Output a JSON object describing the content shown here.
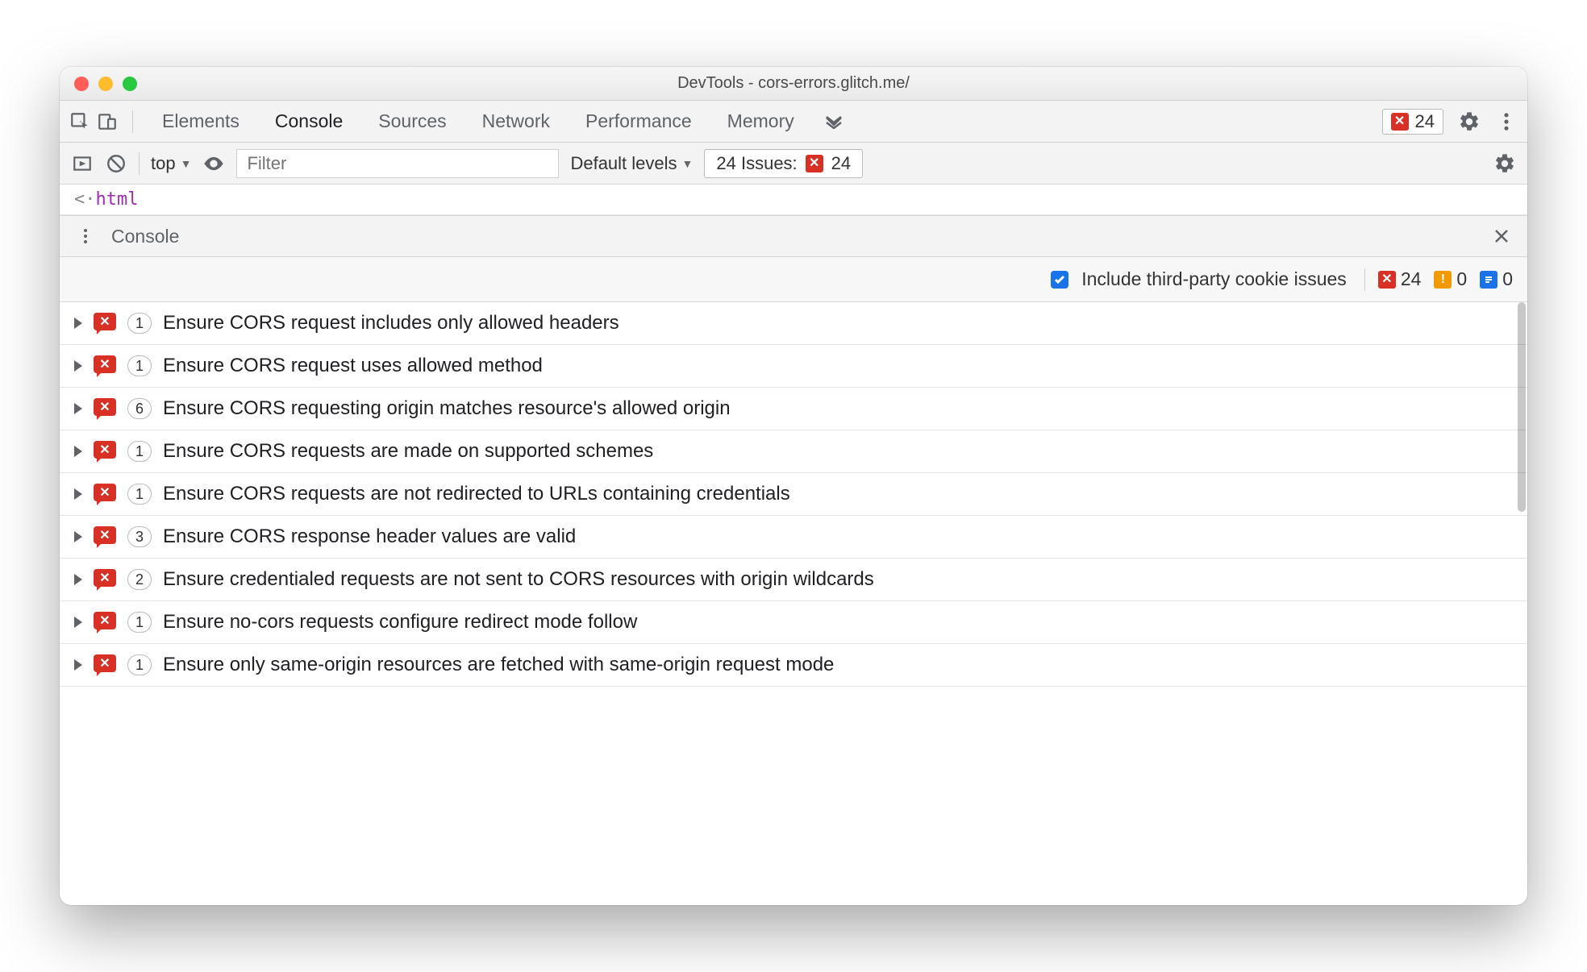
{
  "window": {
    "title": "DevTools - cors-errors.glitch.me/"
  },
  "tabs": {
    "items": [
      "Elements",
      "Console",
      "Sources",
      "Network",
      "Performance",
      "Memory"
    ],
    "active_index": 1,
    "error_badge_count": "24"
  },
  "filterbar": {
    "context": "top",
    "filter_placeholder": "Filter",
    "levels_label": "Default levels",
    "issues_label": "24 Issues:",
    "issues_count": "24"
  },
  "source_line_prefix": "<·",
  "source_line_text": "html",
  "drawer": {
    "title": "Console"
  },
  "issues_toolbar": {
    "checkbox_label": "Include third-party cookie issues",
    "checkbox_checked": true,
    "error_count": "24",
    "warning_count": "0",
    "info_count": "0"
  },
  "issues": [
    {
      "count": "1",
      "title": "Ensure CORS request includes only allowed headers"
    },
    {
      "count": "1",
      "title": "Ensure CORS request uses allowed method"
    },
    {
      "count": "6",
      "title": "Ensure CORS requesting origin matches resource's allowed origin"
    },
    {
      "count": "1",
      "title": "Ensure CORS requests are made on supported schemes"
    },
    {
      "count": "1",
      "title": "Ensure CORS requests are not redirected to URLs containing credentials"
    },
    {
      "count": "3",
      "title": "Ensure CORS response header values are valid"
    },
    {
      "count": "2",
      "title": "Ensure credentialed requests are not sent to CORS resources with origin wildcards"
    },
    {
      "count": "1",
      "title": "Ensure no-cors requests configure redirect mode follow"
    },
    {
      "count": "1",
      "title": "Ensure only same-origin resources are fetched with same-origin request mode"
    }
  ]
}
